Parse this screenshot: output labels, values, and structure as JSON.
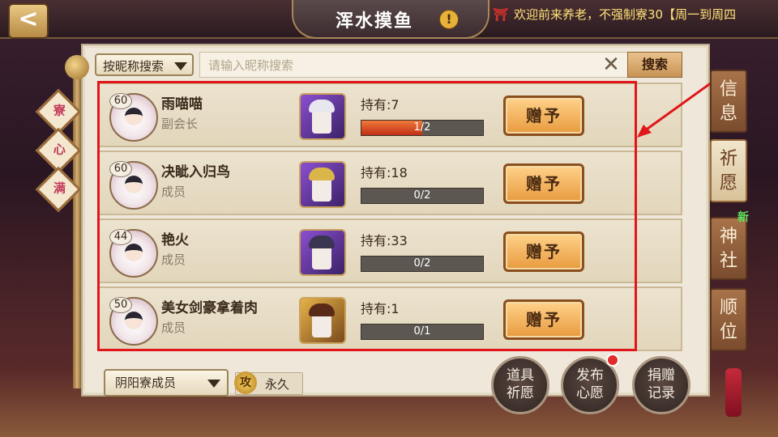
{
  "header": {
    "back_label": "<",
    "title": "浑水摸鱼",
    "warn_symbol": "!",
    "marquee": "欢迎前来养老，不强制寮30【周一到周四"
  },
  "side_tags": [
    "寮",
    "心",
    "满"
  ],
  "search": {
    "type_label": "按昵称搜索",
    "placeholder": "请输入昵称搜索",
    "value": "",
    "clear_symbol": "✕",
    "button_label": "搜索"
  },
  "members": [
    {
      "level": "60",
      "name": "雨喵喵",
      "role": "副会长",
      "owned": "持有:7",
      "progress": "1/2",
      "progress_fraction": 0.5,
      "gift_label": "赠予",
      "shiki_color": "purple"
    },
    {
      "level": "60",
      "name": "决眦入归鸟",
      "role": "成员",
      "owned": "持有:18",
      "progress": "0/2",
      "progress_fraction": 0,
      "gift_label": "赠予",
      "shiki_color": "purple"
    },
    {
      "level": "44",
      "name": "艳火",
      "role": "成员",
      "owned": "持有:33",
      "progress": "0/2",
      "progress_fraction": 0,
      "gift_label": "赠予",
      "shiki_color": "purple"
    },
    {
      "level": "50",
      "name": "美女剑豪拿着肉",
      "role": "成员",
      "owned": "持有:1",
      "progress": "0/1",
      "progress_fraction": 0,
      "gift_label": "赠予",
      "shiki_color": "gold"
    }
  ],
  "footer": {
    "member_filter": "阴阳寮成员",
    "permission_icon": "攻",
    "permission_label": "永久",
    "btn_item_wish": "道具\n祈愿",
    "btn_publish_wish": "发布\n心愿",
    "btn_donation_log": "捐赠\n记录"
  },
  "right_tabs": [
    {
      "label": "信息",
      "active": false
    },
    {
      "label": "祈愿",
      "active": true
    },
    {
      "label": "神社",
      "active": false
    },
    {
      "label": "顺位",
      "active": false
    }
  ],
  "new_badge": "新",
  "colors": {
    "accent_red": "#e0161a",
    "gift_button": "#e89a3e",
    "progress_fill": "#c02f14",
    "new_green": "#5ee35e"
  }
}
